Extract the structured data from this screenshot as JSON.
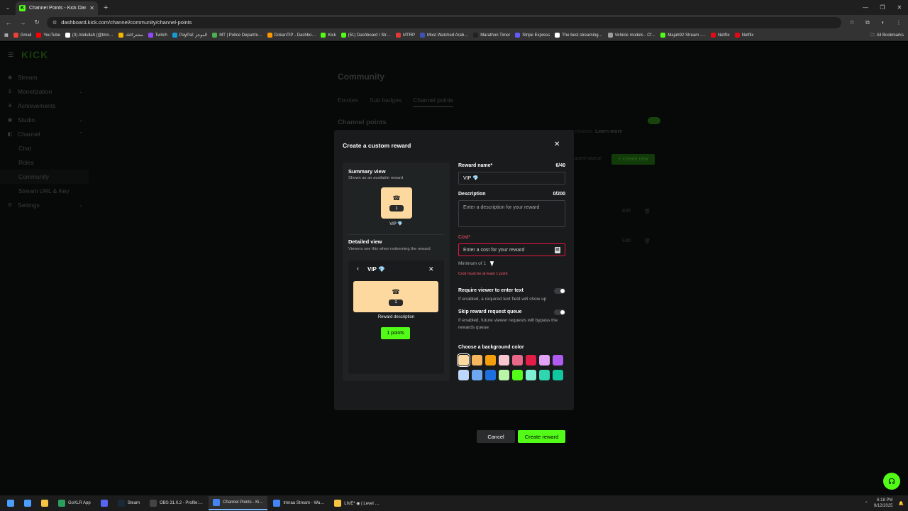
{
  "browser": {
    "tab_title": "Channel Points - Kick Dashbo…",
    "url": "dashboard.kick.com/channel/community/channel-points",
    "bookmarks": [
      {
        "label": "Gmail",
        "color": "#ea4335"
      },
      {
        "label": "YouTube",
        "color": "#ff0000"
      },
      {
        "label": "(3) Abdullah (@tmn…",
        "color": "#ffffff"
      },
      {
        "label": "مشتركاتك",
        "color": "#f5b400"
      },
      {
        "label": "Twitch",
        "color": "#9146ff"
      },
      {
        "label": "PayPal: الموجز",
        "color": "#179bd7"
      },
      {
        "label": "MT | Police Departm…",
        "color": "#4caf50"
      },
      {
        "label": "DokanTIP - Dashbo…",
        "color": "#ff9800"
      },
      {
        "label": "Kick",
        "color": "#53fc18"
      },
      {
        "label": "(51) Dashboard / Str…",
        "color": "#53fc18"
      },
      {
        "label": "MTRP",
        "color": "#e53935"
      },
      {
        "label": "Most Watched Arab…",
        "color": "#3f51b5"
      },
      {
        "label": "Marathon Timer",
        "color": "#222222"
      },
      {
        "label": "Stripe Express",
        "color": "#635bff"
      },
      {
        "label": "The best streaming…",
        "color": "#ffffff"
      },
      {
        "label": "Vehicle models - Cf…",
        "color": "#9e9e9e"
      },
      {
        "label": "Majah92 Stream -…",
        "color": "#53fc18"
      },
      {
        "label": "Netflix",
        "color": "#e50914"
      },
      {
        "label": "Netflix",
        "color": "#e50914"
      }
    ],
    "all_bookmarks": "All Bookmarks"
  },
  "sidebar": {
    "logo": "KICK",
    "items": [
      {
        "label": "Stream",
        "icon": "broadcast-icon",
        "sub": false
      },
      {
        "label": "Monetization",
        "icon": "dollar-icon",
        "sub": false,
        "chev": "⌄"
      },
      {
        "label": "Achievements",
        "icon": "trophy-icon",
        "sub": false
      },
      {
        "label": "Studio",
        "icon": "studio-icon",
        "sub": false,
        "chev": "⌄"
      },
      {
        "label": "Channel",
        "icon": "channel-icon",
        "sub": false,
        "chev": "⌃"
      },
      {
        "label": "Chat",
        "sub": true
      },
      {
        "label": "Roles",
        "sub": true
      },
      {
        "label": "Community",
        "sub": true,
        "active": true
      },
      {
        "label": "Stream URL & Key",
        "sub": true
      },
      {
        "label": "Settings",
        "icon": "gear-icon",
        "sub": false,
        "chev": "⌄"
      }
    ]
  },
  "main": {
    "title": "Community",
    "tabs": [
      "Emotes",
      "Sub badges",
      "Channel points"
    ],
    "section_title": "Channel points",
    "bg_text": "r rewards.",
    "learn_more": "Learn more",
    "bg_queue": "equest queue",
    "bg_create": "+ Create new",
    "edit": "Edit"
  },
  "modal": {
    "title": "Create a custom reward",
    "summary_title": "Summary view",
    "summary_sub": "Shown as an available reward",
    "reward_cost_pill": "1",
    "reward_name_display": "VIP 💎",
    "detailed_title": "Detailed view",
    "detailed_sub": "Viewers see this when redeeming the reward",
    "detailed_name": "VIP 💎",
    "detailed_desc": "Reward description",
    "detailed_points": "1 points",
    "reward_name_label": "Reward name*",
    "reward_name_count": "6/40",
    "reward_name_value": "VIP 💎",
    "description_label": "Description",
    "description_count": "0/200",
    "description_placeholder": "Enter a description for your reward",
    "cost_label": "Cost*",
    "cost_placeholder": "Enter a cost for your reward",
    "cost_hint": "Minimum of 1",
    "cost_error": "Cost must be at least 1 point",
    "require_text_label": "Require viewer to enter text",
    "require_text_desc": "If enabled, a required text field will show up",
    "skip_queue_label": "Skip reward request queue",
    "skip_queue_desc": "If enabled, future viewer requests will bypass the rewards queue",
    "bg_color_label": "Choose a background color",
    "colors_row1": [
      "#fdd9a0",
      "#f6b65e",
      "#f59e0b",
      "#f9c6d0",
      "#e8688a",
      "#e11d48",
      "#e0a3f5",
      "#b15cf0"
    ],
    "colors_row2": [
      "#bcd7fb",
      "#6ea8f0",
      "#1d6fe0",
      "#b9f5a8",
      "#53fc18",
      "#7ff0d4",
      "#2fd6b0",
      "#10c8a0"
    ],
    "cancel": "Cancel",
    "create": "Create reward"
  },
  "taskbar": {
    "items": [
      {
        "label": "",
        "color": "#4a9eff"
      },
      {
        "label": "",
        "color": "#f5c542"
      },
      {
        "label": "GoXLR App",
        "color": "#2c9e5e"
      },
      {
        "label": "",
        "color": "#5865f2"
      },
      {
        "label": "Steam",
        "color": "#1b2838"
      },
      {
        "label": "OBS 31.0.2 - Profile:…",
        "color": "#444444"
      },
      {
        "label": "Channel Points - Ki…",
        "color": "#4285f4",
        "active": true
      },
      {
        "label": "tmnaa Stream - Wa…",
        "color": "#4285f4"
      },
      {
        "label": "LIVE* ◉ | Level …",
        "color": "#f5c542"
      }
    ],
    "time": "6:18 PM",
    "date": "9/12/2025"
  }
}
